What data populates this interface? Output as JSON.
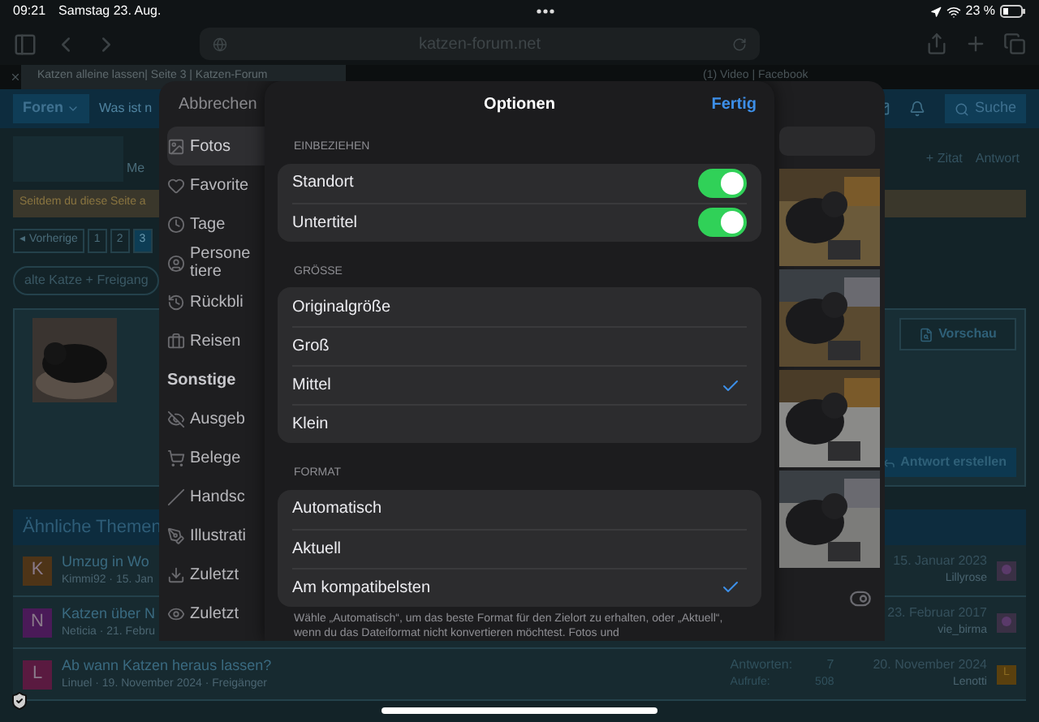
{
  "status_bar": {
    "time": "09:21",
    "date": "Samstag 23. Aug.",
    "battery": "23 %"
  },
  "browser": {
    "url": "katzen-forum.net",
    "tabs": [
      {
        "title": "Katzen alleine lassen| Seite 3 | Katzen-Forum",
        "selected": true
      },
      {
        "title": "(1) Video | Facebook",
        "selected": false
      }
    ]
  },
  "forum": {
    "nav": {
      "forums": "Foren",
      "whats_new": "Was ist n",
      "search": "Suche"
    },
    "sidebar_label": "Me",
    "post_actions": [
      "+ Zitat",
      "Antwort"
    ],
    "notice": "Seitdem du diese Seite a",
    "pagination": [
      {
        "label": "◂ Vorherige",
        "selected": false
      },
      {
        "label": "1",
        "selected": false
      },
      {
        "label": "2",
        "selected": false
      },
      {
        "label": "3",
        "selected": true
      }
    ],
    "tag": "alte Katze + Freigang",
    "preview_button": "Vorschau",
    "submit_button": "Antwort erstellen",
    "similar_title": "Ähnliche Themen",
    "threads": [
      {
        "initial": "K",
        "color": "#4e3417",
        "title": "Umzug in Wo",
        "meta": "Kimmi92 · 15. Jan",
        "date": "15. Januar 2023",
        "user": "Lillyrose"
      },
      {
        "initial": "N",
        "color": "#4a1a58",
        "title": "Katzen über N",
        "meta": "Neticia · 21. Febru",
        "date": "23. Februar 2017",
        "user": "vie_birma"
      },
      {
        "initial": "L",
        "color": "#5a1a40",
        "title": "Ab wann Katzen heraus lassen?",
        "meta": "Linuel · 19. November 2024 · Freigänger",
        "replies_label": "Antworten:",
        "replies": "7",
        "views_label": "Aufrufe:",
        "views": "508",
        "date": "20. November 2024",
        "user": "Lenotti",
        "user_initial": "L"
      }
    ]
  },
  "picker": {
    "cancel": "Abbrechen",
    "items": [
      {
        "kind": "item",
        "label": "Fotos",
        "selected": true
      },
      {
        "kind": "item",
        "label": "Favorite",
        "selected": false
      },
      {
        "kind": "item",
        "label": "Tage",
        "selected": false
      },
      {
        "kind": "item",
        "label": "Persone\ntiere",
        "selected": false
      },
      {
        "kind": "item",
        "label": "Rückbli",
        "selected": false
      },
      {
        "kind": "item",
        "label": "Reisen",
        "selected": false
      },
      {
        "kind": "header",
        "label": "Sonstige"
      },
      {
        "kind": "item",
        "label": "Ausgeb",
        "selected": false
      },
      {
        "kind": "item",
        "label": "Belege",
        "selected": false
      },
      {
        "kind": "item",
        "label": "Handsc",
        "selected": false
      },
      {
        "kind": "item",
        "label": "Illustrati",
        "selected": false
      },
      {
        "kind": "item",
        "label": "Zuletzt",
        "selected": false
      },
      {
        "kind": "item",
        "label": "Zuletzt",
        "selected": false
      }
    ]
  },
  "options": {
    "title": "Optionen",
    "done": "Fertig",
    "sections": [
      {
        "header": "EINBEZIEHEN",
        "rows": [
          {
            "kind": "toggle",
            "label": "Standort",
            "on": true
          },
          {
            "kind": "toggle",
            "label": "Untertitel",
            "on": true
          }
        ]
      },
      {
        "header": "GRÖSSE",
        "rows": [
          {
            "kind": "choice",
            "label": "Originalgröße",
            "selected": false
          },
          {
            "kind": "choice",
            "label": "Groß",
            "selected": false
          },
          {
            "kind": "choice",
            "label": "Mittel",
            "selected": true
          },
          {
            "kind": "choice",
            "label": "Klein",
            "selected": false
          }
        ]
      },
      {
        "header": "FORMAT",
        "rows": [
          {
            "kind": "choice",
            "label": "Automatisch",
            "selected": false
          },
          {
            "kind": "choice",
            "label": "Aktuell",
            "selected": false
          },
          {
            "kind": "choice",
            "label": "Am kompatibelsten",
            "selected": true
          }
        ],
        "footer": "Wähle „Automatisch“, um das beste Format für den Zielort zu erhalten, oder „Aktuell“, wenn du das Dateiformat nicht konvertieren möchtest. Fotos und"
      }
    ]
  }
}
